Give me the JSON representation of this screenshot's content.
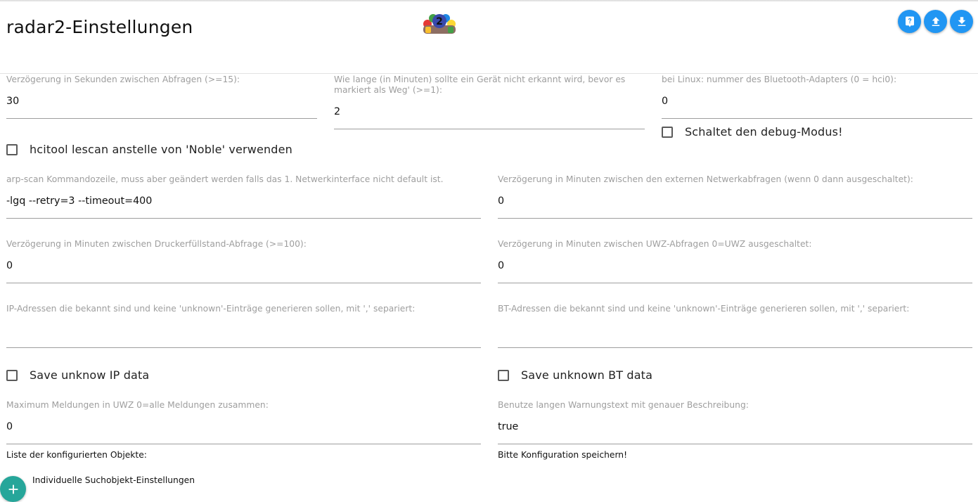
{
  "header": {
    "title": "radar2-Einstellungen",
    "logo_text": "2",
    "buttons": [
      "help-icon",
      "upload-icon",
      "download-icon"
    ],
    "accent": "#2196f3"
  },
  "fields": {
    "delay_seconds": {
      "label": "Verzögerung in Sekunden zwischen Abfragen (>=15):",
      "value": "30"
    },
    "away_minutes": {
      "label": "Wie lange (in Minuten) sollte ein Gerät nicht erkannt wird, bevor es markiert als Weg' (>=1):",
      "value": "2"
    },
    "bt_adapter": {
      "label": "bei Linux: nummer des Bluetooth-Adapters (0 = hci0):",
      "value": "0"
    },
    "arp_scan": {
      "label": "arp-scan Kommandozeile, muss aber geändert werden falls das 1. Netwerkinterface nicht default ist.",
      "value": "-lgq --retry=3 --timeout=400"
    },
    "ext_network_delay": {
      "label": "Verzögerung in Minuten zwischen den externen Netwerkabfragen (wenn 0 dann ausgeschaltet):",
      "value": "0"
    },
    "printer_delay": {
      "label": "Verzögerung in Minuten zwischen Druckerfüllstand-Abfrage (>=100):",
      "value": "0"
    },
    "uwz_delay": {
      "label": "Verzögerung in Minuten zwischen UWZ-Abfragen 0=UWZ ausgeschaltet:",
      "value": "0"
    },
    "known_ips": {
      "label": "IP-Adressen die bekannt sind und keine 'unknown'-Einträge generieren sollen, mit ',' separiert:",
      "value": ""
    },
    "known_bts": {
      "label": "BT-Adressen die bekannt sind und keine 'unknown'-Einträge generieren sollen, mit ',' separiert:",
      "value": ""
    },
    "uwz_max": {
      "label": "Maximum Meldungen in UWZ 0=alle Meldungen zusammen:",
      "value": "0"
    },
    "long_warning": {
      "label": "Benutze langen Warnungstext mit genauer Beschreibung:",
      "value": "true"
    }
  },
  "checkboxes": {
    "debug": {
      "label": "Schaltet den debug-Modus!",
      "checked": false
    },
    "hcitool": {
      "label": "hcitool lescan anstelle von 'Noble' verwenden",
      "checked": false
    },
    "save_ip": {
      "label": "Save unknow IP data",
      "checked": false
    },
    "save_bt": {
      "label": "Save unknown BT data",
      "checked": false
    }
  },
  "footer": {
    "objects_list_label": "Liste der konfigurierten Objekte:",
    "save_hint": "Bitte Konfiguration speichern!",
    "add_label": "Individuelle Suchobjekt-Einstellungen",
    "fab_color": "#26a69a"
  }
}
